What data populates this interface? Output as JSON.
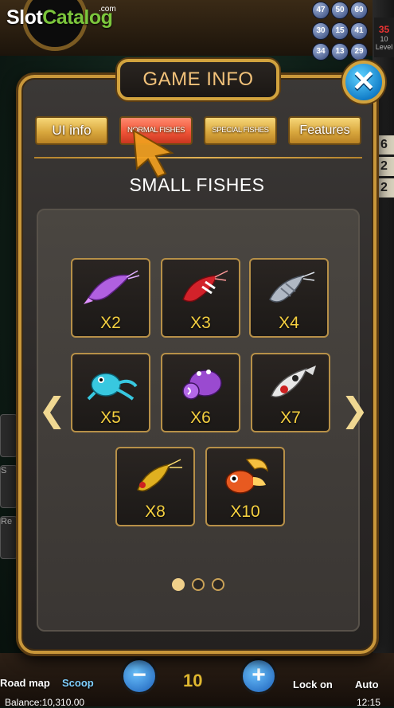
{
  "brand": {
    "name_prefix": "Slot",
    "name_suffix": "Catalog",
    "com": ".com"
  },
  "background": {
    "ball_numbers": [
      "47",
      "50",
      "60",
      "30",
      "15",
      "41",
      "34",
      "13",
      "29"
    ],
    "level_label": "10 Level",
    "level_number": "35",
    "side_numbers": [
      "6",
      "2",
      "2"
    ],
    "left_labels": [
      "S",
      "Re"
    ],
    "bottom": {
      "road_map_label": "Road map",
      "scoop_label": "Scoop",
      "minus_symbol": "−",
      "bet_value": "10",
      "plus_symbol": "+",
      "lock_on_label": "Lock on",
      "auto_label": "Auto",
      "balance_text": "Balance:10,310.00",
      "time_text": "12:15"
    }
  },
  "dialog": {
    "title": "GAME INFO",
    "close_symbol": "✕",
    "tabs": [
      {
        "label": "UI info",
        "active": false
      },
      {
        "label": "NORMAL FISHES",
        "active": true
      },
      {
        "label": "SPECIAL FISHES",
        "active": false
      },
      {
        "label": "Features",
        "active": false
      }
    ],
    "section_title": "SMALL FISHES",
    "fishes": [
      {
        "multiplier": "X2",
        "icon": "purple-shrimp-icon",
        "color": "#b060e0"
      },
      {
        "multiplier": "X3",
        "icon": "red-shrimp-icon",
        "color": "#d2222a"
      },
      {
        "multiplier": "X4",
        "icon": "silver-fish-icon",
        "color": "#b0b8c4"
      },
      {
        "multiplier": "X5",
        "icon": "cyan-frog-icon",
        "color": "#38c8e0"
      },
      {
        "multiplier": "X6",
        "icon": "purple-crab-icon",
        "color": "#9a4ad0"
      },
      {
        "multiplier": "X7",
        "icon": "koi-fish-icon",
        "color": "#e8e8e8"
      },
      {
        "multiplier": "X8",
        "icon": "golden-shrimp-icon",
        "color": "#e0b020"
      },
      {
        "multiplier": "X10",
        "icon": "goldfish-icon",
        "color": "#e85a20"
      }
    ],
    "prev_symbol": "❮",
    "next_symbol": "❯",
    "page_count": 3,
    "current_page": 1
  }
}
